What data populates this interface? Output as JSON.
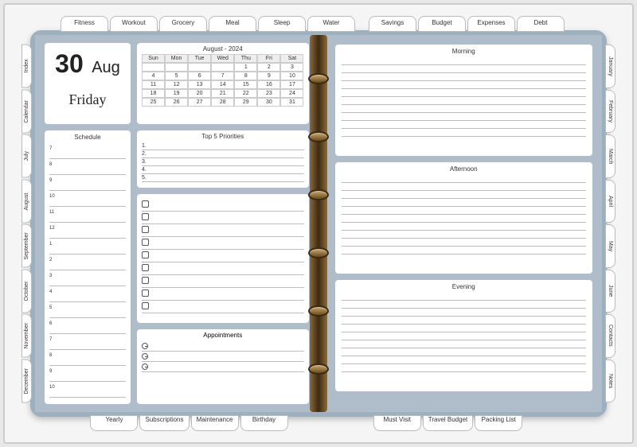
{
  "date": {
    "day": "30",
    "month": "Aug",
    "weekday": "Friday"
  },
  "calendar": {
    "title": "August - 2024",
    "week_headers": [
      "Sun",
      "Mon",
      "Tue",
      "Wed",
      "Thu",
      "Fri",
      "Sat"
    ],
    "cells": [
      "",
      "",
      "",
      "",
      "1",
      "2",
      "3",
      "4",
      "5",
      "6",
      "7",
      "8",
      "9",
      "10",
      "11",
      "12",
      "13",
      "14",
      "15",
      "16",
      "17",
      "18",
      "19",
      "20",
      "21",
      "22",
      "23",
      "24",
      "25",
      "26",
      "27",
      "28",
      "29",
      "30",
      "31"
    ]
  },
  "left": {
    "schedule_title": "Schedule",
    "hours": [
      "7",
      "8",
      "9",
      "10",
      "11",
      "12",
      "1",
      "2",
      "3",
      "4",
      "5",
      "6",
      "7",
      "8",
      "9",
      "10"
    ],
    "priorities_title": "Top 5 Priorities",
    "priorities": [
      "1.",
      "2.",
      "3.",
      "4.",
      "5."
    ],
    "checklist_count": 9,
    "appointments_title": "Appointments",
    "appointment_count": 3
  },
  "right": {
    "morning": "Morning",
    "afternoon": "Afternoon",
    "evening": "Evening",
    "lines_each": 10
  },
  "tabs": {
    "top_left": [
      "Fitness",
      "Workout",
      "Grocery",
      "Meal",
      "Sleep",
      "Water"
    ],
    "top_right": [
      "Savings",
      "Budget",
      "Expenses",
      "Debt"
    ],
    "right": [
      "January",
      "February",
      "March",
      "April",
      "May",
      "June",
      "Contacts",
      "Notes"
    ],
    "left": [
      "Index",
      "Calendar",
      "July",
      "August",
      "September",
      "October",
      "November",
      "December"
    ],
    "bottom_left": [
      "Yearly",
      "Subscriptions",
      "Maintenance",
      "Birthday"
    ],
    "bottom_right": [
      "Must Visit",
      "Travel Budget",
      "Packing List"
    ]
  }
}
